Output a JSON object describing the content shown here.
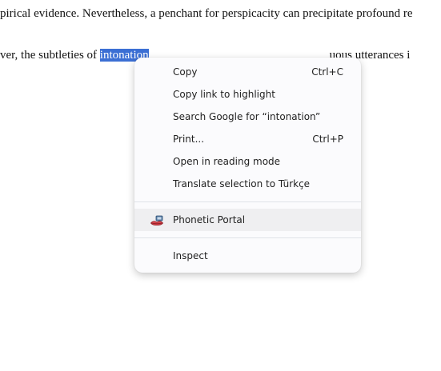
{
  "document": {
    "line1": "pirical evidence. Nevertheless, a penchant for perspicacity can precipitate profound re",
    "line2_before": "ver, the subtleties of ",
    "line2_selected": "intonation",
    "line2_after": "uous utterances i"
  },
  "context_menu": {
    "items": [
      {
        "label": "Copy",
        "shortcut": "Ctrl+C"
      },
      {
        "label": "Copy link to highlight",
        "shortcut": ""
      },
      {
        "label": "Search Google for “intonation”",
        "shortcut": ""
      },
      {
        "label": "Print...",
        "shortcut": "Ctrl+P"
      },
      {
        "label": "Open in reading mode",
        "shortcut": ""
      },
      {
        "label": "Translate selection to Türkçe",
        "shortcut": ""
      }
    ],
    "extension": {
      "label": "Phonetic Portal",
      "icon": "lips-icon"
    },
    "inspect": {
      "label": "Inspect"
    }
  },
  "colors": {
    "selection": "#3b6fd4",
    "menu_background": "#fbfbfd",
    "hover_background": "#efeff1"
  }
}
